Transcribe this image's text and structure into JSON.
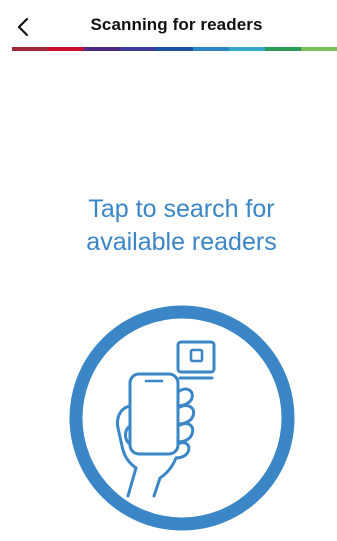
{
  "header": {
    "title": "Scanning for readers",
    "back_icon": "chevron-left-icon"
  },
  "brand_bar_colors": [
    "#9e2a3a",
    "#c8102e",
    "#4c2a85",
    "#3a3b9a",
    "#1f4fa0",
    "#2b86c8",
    "#36a6c9",
    "#2a9a56",
    "#7bbf5a"
  ],
  "prompt": {
    "line1": "Tap to search for",
    "line2": "available readers"
  },
  "illustration": {
    "icon": "hand-holding-phone-scan-icon",
    "accent_color": "#3a86c6"
  }
}
